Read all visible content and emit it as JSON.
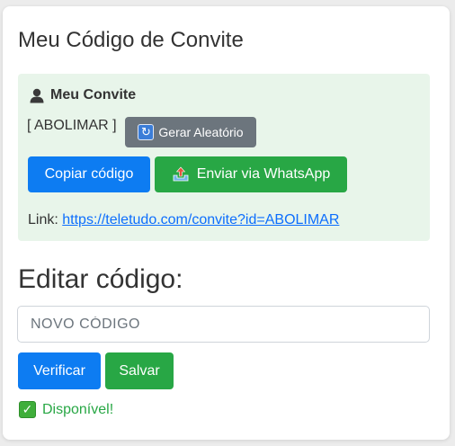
{
  "card": {
    "title": "Meu Código de Convite"
  },
  "invite": {
    "header_icon": "person-silhouette-icon",
    "header_label": "Meu Convite",
    "code_display": "[ ABOLIMAR ]",
    "random_button": {
      "icon": "refresh-icon",
      "label": "Gerar Aleatório"
    },
    "copy_button_label": "Copiar código",
    "whatsapp_button": {
      "icon": "upload-icon",
      "label": "Enviar via WhatsApp"
    },
    "link_prefix": "Link:",
    "link_url": "https://teletudo.com/convite?id=ABOLIMAR"
  },
  "edit": {
    "title": "Editar código:",
    "input_placeholder": "NOVO CÓDIGO",
    "input_value": "",
    "verify_button_label": "Verificar",
    "save_button_label": "Salvar",
    "status_icon": "check-mark-icon",
    "status_text": "Disponível!"
  },
  "colors": {
    "primary": "#0d7cf2",
    "success": "#28a745",
    "secondary": "#6c757d",
    "invite_bg": "#e8f5ea",
    "link": "#0d6efd"
  }
}
